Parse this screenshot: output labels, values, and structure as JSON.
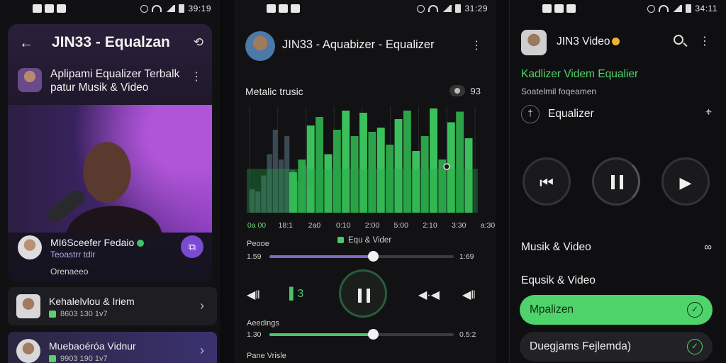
{
  "colors": {
    "accent_green": "#4fd36b",
    "accent_purple": "#7a4ad0",
    "background": "#111114"
  },
  "panel1": {
    "status": {
      "time": "39:19"
    },
    "title": "JIN33 - Equalzan",
    "app": {
      "title": "Aplipami Equalizer Terbalk patur Musik & Video"
    },
    "artist": {
      "name": "MI6Sceefer Fedaio",
      "sub": "Teoastrr tdlr",
      "foot": "Orenaeeo"
    },
    "list": [
      {
        "title": "Kehalelvlou & Iriem",
        "sub": "8603 130 1v7"
      },
      {
        "title": "Muebaoéróa Vidnur",
        "sub": "9903 190 1v7"
      }
    ]
  },
  "panel2": {
    "status": {
      "time": "31:29"
    },
    "title": "JIN33 - Aquabizer - Equalizer",
    "section": "Metalic trusic",
    "badge": "93",
    "visualizer": {
      "type": "spectrum",
      "bars_back": [
        0.22,
        0.2,
        0.35,
        0.55,
        0.78,
        0.5,
        0.72,
        0.4,
        0.3,
        0.45,
        0.25
      ],
      "bars_front": [
        0.38,
        0.5,
        0.82,
        0.9,
        0.55,
        0.78,
        0.96,
        0.72,
        0.94,
        0.76,
        0.8,
        0.64,
        0.88,
        0.96,
        0.58,
        0.72,
        0.98,
        0.5,
        0.85,
        0.95,
        0.7
      ]
    },
    "ticks": [
      "0a 00",
      "18:1",
      "2a0",
      "0:10",
      "2:00",
      "5:00",
      "2:10",
      "3:30",
      "a:30"
    ],
    "eq_tag": "Equ & Vider",
    "slider1": {
      "label": "Peooe",
      "left": "1.59",
      "right": "1:69",
      "fill_color": "#7b6ac4",
      "value": 0.56
    },
    "slider2": {
      "label": "Aeedings",
      "left": "1.30",
      "right": "0.5:2",
      "fill_color": "#49c56a",
      "value": 0.56
    },
    "controls": {
      "badge_num": "3"
    },
    "foot": "Pane Vrisle"
  },
  "panel3": {
    "status": {
      "time": "34:11"
    },
    "title": "JIN3 Video",
    "green_title": "Kadlizer Videm Equalier",
    "sub": "Soatelmil foqeamen",
    "eq_label": "Equalizer",
    "row1": "Musik & Video",
    "row2": "Equsik & Video",
    "pill_active": "Mpalizen",
    "pill_inactive": "Duegjams Fejlemda)"
  }
}
